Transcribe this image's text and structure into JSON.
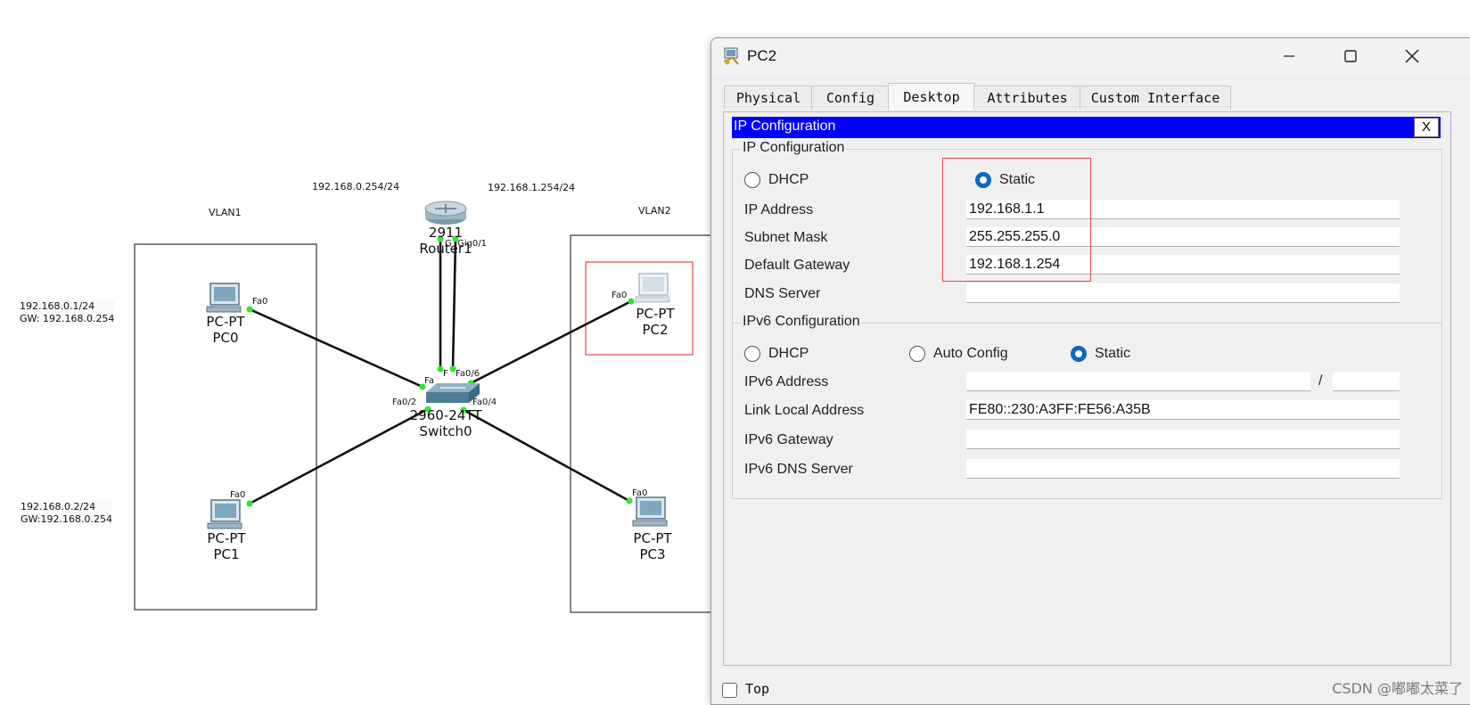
{
  "topology": {
    "vlan1_label": "VLAN1",
    "vlan2_label": "VLAN2",
    "router_ip_left": "192.168.0.254/24",
    "router_ip_right": "192.168.1.254/24",
    "router": {
      "model": "2911",
      "name": "Router1",
      "port_left": "G",
      "port_right": "Gig0/1"
    },
    "switch": {
      "model": "2960-24TT",
      "name": "Switch0",
      "port_top_left": "F",
      "port_top_mid": "Fa",
      "port_fa06": "Fa0/6",
      "port_fa02": "Fa0/2",
      "port_fa04": "Fa0/4"
    },
    "pc0": {
      "type": "PC-PT",
      "name": "PC0",
      "port": "Fa0",
      "note_ip": "192.168.0.1/24",
      "note_gw": "GW:  192.168.0.254"
    },
    "pc1": {
      "type": "PC-PT",
      "name": "PC1",
      "port": "Fa0",
      "note_ip": "192.168.0.2/24",
      "note_gw": "GW:192.168.0.254"
    },
    "pc2": {
      "type": "PC-PT",
      "name": "PC2",
      "port": "Fa0"
    },
    "pc3": {
      "type": "PC-PT",
      "name": "PC3",
      "port": "Fa0"
    }
  },
  "window": {
    "title": "PC2",
    "tabs": [
      {
        "label": "Physical"
      },
      {
        "label": "Config"
      },
      {
        "label": "Desktop",
        "active": true
      },
      {
        "label": "Attributes"
      },
      {
        "label": "Custom Interface"
      }
    ],
    "ip_config": {
      "header": "IP Configuration",
      "close": "X",
      "ipv4_group_title": "IP Configuration",
      "dhcp_label": "DHCP",
      "static_label": "Static",
      "mode": "Static",
      "ip_address_label": "IP Address",
      "ip_address": "192.168.1.1",
      "subnet_mask_label": "Subnet Mask",
      "subnet_mask": "255.255.255.0",
      "default_gateway_label": "Default Gateway",
      "default_gateway": "192.168.1.254",
      "dns_server_label": "DNS Server",
      "dns_server": "",
      "ipv6_group_title": "IPv6 Configuration",
      "ipv6_dhcp_label": "DHCP",
      "ipv6_auto_label": "Auto Config",
      "ipv6_static_label": "Static",
      "ipv6_mode": "Static",
      "ipv6_address_label": "IPv6 Address",
      "ipv6_address": "",
      "ipv6_prefix": "",
      "ipv6_slash": "/",
      "link_local_label": "Link Local Address",
      "link_local": "FE80::230:A3FF:FE56:A35B",
      "ipv6_gateway_label": "IPv6 Gateway",
      "ipv6_gateway": "",
      "ipv6_dns_label": "IPv6 DNS Server",
      "ipv6_dns": ""
    },
    "top_checkbox_label": "Top",
    "top_checked": false
  },
  "watermark": "CSDN @嘟嘟太菜了",
  "colors": {
    "header_blue": "#0000ff",
    "radio_selected": "#0f65c4",
    "link_endpoint": "#2ee82e",
    "highlight_red": "#e04a4a"
  }
}
